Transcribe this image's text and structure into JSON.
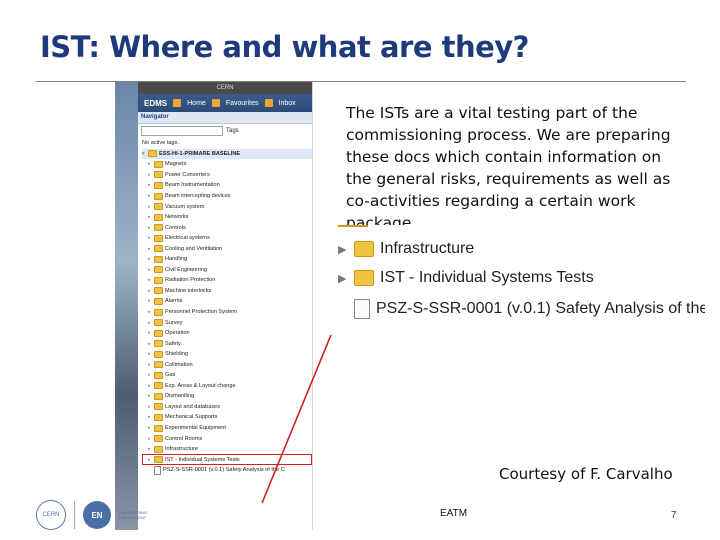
{
  "slide": {
    "title": "IST: Where and what are they?",
    "body": "The ISTs are a vital testing part of the commissioning process. We are preparing these docs which contain information on the general risks, requirements as well as co-activities regarding a certain work package",
    "courtesy": "Courtesy of F. Carvalho",
    "footer_center": "EATM",
    "page_number": "7",
    "accent_color": "#1f3a7a",
    "highlight_color": "#d21f1f"
  },
  "edms": {
    "top_banner": "CERN",
    "logo": "EDMS",
    "toolbar": [
      "Home",
      "Favourites",
      "Inbox"
    ],
    "panel_title": "Navigator",
    "tags_label": "Tags",
    "no_tags": "No active tags.",
    "root": "ESS-HI-1-PRIMARE BASELINE",
    "items": [
      "Magnets",
      "Power Converters",
      "Beam Instrumentation",
      "Beam intercepting devices",
      "Vacuum system",
      "Networks",
      "Controls",
      "Electrical systems",
      "Cooling and Ventilation",
      "Handling",
      "Civil Engineering",
      "Radiation Protection",
      "Machine interlocks",
      "Alarms",
      "Personnel Protection System",
      "Survey",
      "Operation",
      "Safety",
      "Shielding",
      "Collimation",
      "Gas",
      "Exp. Areas & Layout change",
      "Dismantling",
      "Layout and databases",
      "Mechanical Supports",
      "Experimental Equipment",
      "Control Rooms",
      "Infrastructure",
      "IST - Individual Systems Tests"
    ],
    "doc_item": "PSZ-S-SSR-0001 (v.0.1) Safety Analysis of the C"
  },
  "zoom": {
    "row1": "Infrastructure",
    "row2": "IST - Individual Systems Tests",
    "row3": "PSZ-S-SSR-0001 (v.0.1) Safety Analysis of the"
  },
  "logos": {
    "cern": "CERN",
    "en": "EN",
    "en_sub": "ENGINEERING DEPARTMENT"
  }
}
